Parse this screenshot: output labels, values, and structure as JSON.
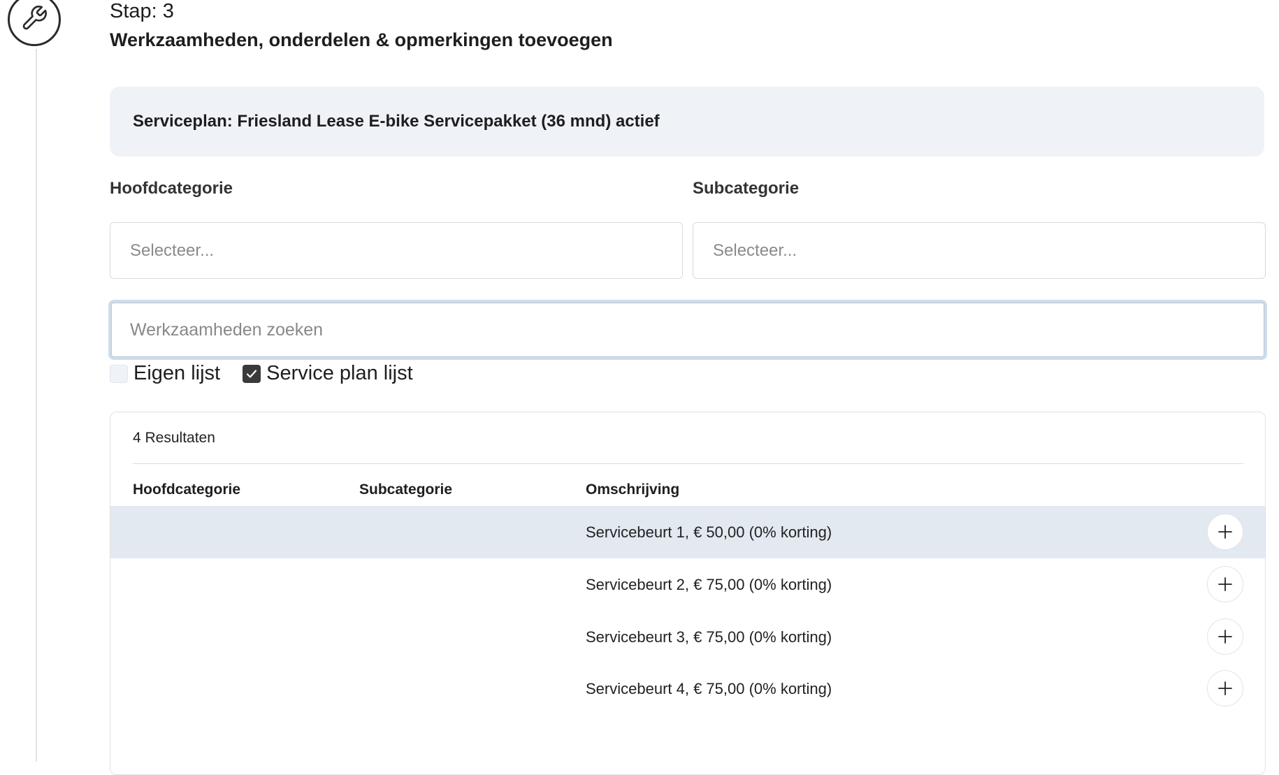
{
  "step": {
    "label": "Stap: 3",
    "title": "Werkzaamheden, onderdelen & opmerkingen toevoegen",
    "icon": "wrench-icon"
  },
  "service_plan": {
    "text": "Serviceplan: Friesland Lease E-bike Servicepakket (36 mnd) actief"
  },
  "filters": {
    "main_category_label": "Hoofdcategorie",
    "main_category_placeholder": "Selecteer...",
    "sub_category_label": "Subcategorie",
    "sub_category_placeholder": "Selecteer..."
  },
  "search": {
    "placeholder": "Werkzaamheden zoeken",
    "value": ""
  },
  "lists": [
    {
      "label": "Eigen lijst",
      "checked": false
    },
    {
      "label": "Service plan lijst",
      "checked": true
    }
  ],
  "results": {
    "count_text": "4 Resultaten",
    "columns": [
      "Hoofdcategorie",
      "Subcategorie",
      "Omschrijving"
    ],
    "rows": [
      {
        "main": "",
        "sub": "",
        "description": "Servicebeurt 1, € 50,00 (0% korting)"
      },
      {
        "main": "",
        "sub": "",
        "description": "Servicebeurt 2, € 75,00 (0% korting)"
      },
      {
        "main": "",
        "sub": "",
        "description": "Servicebeurt 3, € 75,00 (0% korting)"
      },
      {
        "main": "",
        "sub": "",
        "description": "Servicebeurt 4, € 75,00 (0% korting)"
      }
    ]
  },
  "colors": {
    "panel_bg": "#eff2f7",
    "row_highlight": "#e3e9f0",
    "focus_ring": "#cfdce9"
  }
}
